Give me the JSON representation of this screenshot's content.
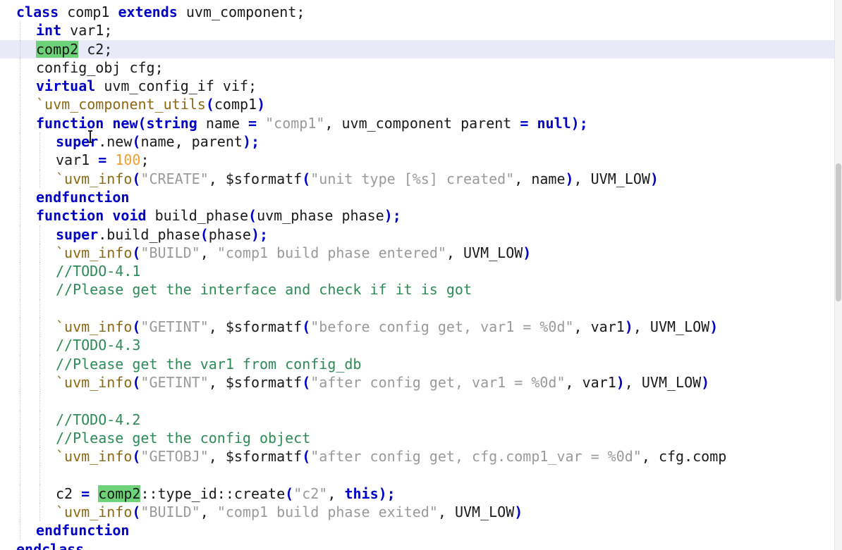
{
  "editor": {
    "language": "systemverilog",
    "current_line": 2,
    "colors": {
      "keyword": "#0000c8",
      "macro": "#8b6914",
      "string": "#9a9a9a",
      "number": "#f0a030",
      "comment": "#2e8b57",
      "match_highlight": "#6ed27a",
      "current_line": "#e8eaf8"
    },
    "lines": [
      {
        "indent": 0,
        "tokens": [
          {
            "t": "kw",
            "v": "class"
          },
          {
            "t": "id",
            "v": " comp1 "
          },
          {
            "t": "kw",
            "v": "extends"
          },
          {
            "t": "id",
            "v": " uvm_component;"
          }
        ]
      },
      {
        "indent": 1,
        "tokens": [
          {
            "t": "kw",
            "v": "int"
          },
          {
            "t": "id",
            "v": " var1;"
          }
        ]
      },
      {
        "indent": 1,
        "tokens": [
          {
            "t": "hl",
            "v": "comp2"
          },
          {
            "t": "id",
            "v": " c2;"
          }
        ]
      },
      {
        "indent": 1,
        "tokens": [
          {
            "t": "id",
            "v": "config_obj cfg;"
          }
        ]
      },
      {
        "indent": 1,
        "tokens": [
          {
            "t": "kw",
            "v": "virtual"
          },
          {
            "t": "id",
            "v": " uvm_config_if vif;"
          }
        ]
      },
      {
        "indent": 1,
        "tokens": [
          {
            "t": "macro",
            "v": "`uvm_component_utils"
          },
          {
            "t": "op",
            "v": "("
          },
          {
            "t": "id",
            "v": "comp1"
          },
          {
            "t": "op",
            "v": ")"
          }
        ]
      },
      {
        "indent": 1,
        "tokens": [
          {
            "t": "kw",
            "v": "function"
          },
          {
            "t": "id",
            "v": " "
          },
          {
            "t": "kw",
            "v": "new"
          },
          {
            "t": "op",
            "v": "("
          },
          {
            "t": "kw",
            "v": "string"
          },
          {
            "t": "id",
            "v": " name "
          },
          {
            "t": "op",
            "v": "="
          },
          {
            "t": "id",
            "v": " "
          },
          {
            "t": "str",
            "v": "\"comp1\""
          },
          {
            "t": "id",
            "v": ", uvm_component parent "
          },
          {
            "t": "op",
            "v": "="
          },
          {
            "t": "id",
            "v": " "
          },
          {
            "t": "kw",
            "v": "null"
          },
          {
            "t": "op",
            "v": ");"
          }
        ]
      },
      {
        "indent": 2,
        "tokens": [
          {
            "t": "kw",
            "v": "super"
          },
          {
            "t": "id",
            "v": ".new"
          },
          {
            "t": "op",
            "v": "("
          },
          {
            "t": "id",
            "v": "name, parent"
          },
          {
            "t": "op",
            "v": ");"
          }
        ]
      },
      {
        "indent": 2,
        "tokens": [
          {
            "t": "id",
            "v": "var1 "
          },
          {
            "t": "op",
            "v": "="
          },
          {
            "t": "id",
            "v": " "
          },
          {
            "t": "num",
            "v": "100"
          },
          {
            "t": "id",
            "v": ";"
          }
        ]
      },
      {
        "indent": 2,
        "tokens": [
          {
            "t": "macro",
            "v": "`uvm_info"
          },
          {
            "t": "op",
            "v": "("
          },
          {
            "t": "str",
            "v": "\"CREATE\""
          },
          {
            "t": "id",
            "v": ", $sformatf"
          },
          {
            "t": "op",
            "v": "("
          },
          {
            "t": "str",
            "v": "\"unit type [%s] created\""
          },
          {
            "t": "id",
            "v": ", name"
          },
          {
            "t": "op",
            "v": ")"
          },
          {
            "t": "id",
            "v": ", UVM_LOW"
          },
          {
            "t": "op",
            "v": ")"
          }
        ]
      },
      {
        "indent": 1,
        "tokens": [
          {
            "t": "kw",
            "v": "endfunction"
          }
        ]
      },
      {
        "indent": 1,
        "tokens": [
          {
            "t": "kw",
            "v": "function"
          },
          {
            "t": "id",
            "v": " "
          },
          {
            "t": "kw",
            "v": "void"
          },
          {
            "t": "id",
            "v": " build_phase"
          },
          {
            "t": "op",
            "v": "("
          },
          {
            "t": "id",
            "v": "uvm_phase phase"
          },
          {
            "t": "op",
            "v": ");"
          }
        ]
      },
      {
        "indent": 2,
        "tokens": [
          {
            "t": "kw",
            "v": "super"
          },
          {
            "t": "id",
            "v": ".build_phase"
          },
          {
            "t": "op",
            "v": "("
          },
          {
            "t": "id",
            "v": "phase"
          },
          {
            "t": "op",
            "v": ");"
          }
        ]
      },
      {
        "indent": 2,
        "tokens": [
          {
            "t": "macro",
            "v": "`uvm_info"
          },
          {
            "t": "op",
            "v": "("
          },
          {
            "t": "str",
            "v": "\"BUILD\""
          },
          {
            "t": "id",
            "v": ", "
          },
          {
            "t": "str",
            "v": "\"comp1 build phase entered\""
          },
          {
            "t": "id",
            "v": ", UVM_LOW"
          },
          {
            "t": "op",
            "v": ")"
          }
        ]
      },
      {
        "indent": 2,
        "tokens": [
          {
            "t": "cmt",
            "v": "//TODO-4.1"
          }
        ]
      },
      {
        "indent": 2,
        "tokens": [
          {
            "t": "cmt",
            "v": "//Please get the interface and check if it is got"
          }
        ]
      },
      {
        "indent": 2,
        "tokens": []
      },
      {
        "indent": 2,
        "tokens": [
          {
            "t": "macro",
            "v": "`uvm_info"
          },
          {
            "t": "op",
            "v": "("
          },
          {
            "t": "str",
            "v": "\"GETINT\""
          },
          {
            "t": "id",
            "v": ", $sformatf"
          },
          {
            "t": "op",
            "v": "("
          },
          {
            "t": "str",
            "v": "\"before config get, var1 = %0d\""
          },
          {
            "t": "id",
            "v": ", var1"
          },
          {
            "t": "op",
            "v": ")"
          },
          {
            "t": "id",
            "v": ", UVM_LOW"
          },
          {
            "t": "op",
            "v": ")"
          }
        ]
      },
      {
        "indent": 2,
        "tokens": [
          {
            "t": "cmt",
            "v": "//TODO-4.3"
          }
        ]
      },
      {
        "indent": 2,
        "tokens": [
          {
            "t": "cmt",
            "v": "//Please get the var1 from config_db"
          }
        ]
      },
      {
        "indent": 2,
        "tokens": [
          {
            "t": "macro",
            "v": "`uvm_info"
          },
          {
            "t": "op",
            "v": "("
          },
          {
            "t": "str",
            "v": "\"GETINT\""
          },
          {
            "t": "id",
            "v": ", $sformatf"
          },
          {
            "t": "op",
            "v": "("
          },
          {
            "t": "str",
            "v": "\"after config get, var1 = %0d\""
          },
          {
            "t": "id",
            "v": ", var1"
          },
          {
            "t": "op",
            "v": ")"
          },
          {
            "t": "id",
            "v": ", UVM_LOW"
          },
          {
            "t": "op",
            "v": ")"
          }
        ]
      },
      {
        "indent": 2,
        "tokens": []
      },
      {
        "indent": 2,
        "tokens": [
          {
            "t": "cmt",
            "v": "//TODO-4.2"
          }
        ]
      },
      {
        "indent": 2,
        "tokens": [
          {
            "t": "cmt",
            "v": "//Please get the config object"
          }
        ]
      },
      {
        "indent": 2,
        "tokens": [
          {
            "t": "macro",
            "v": "`uvm_info"
          },
          {
            "t": "op",
            "v": "("
          },
          {
            "t": "str",
            "v": "\"GETOBJ\""
          },
          {
            "t": "id",
            "v": ", $sformatf"
          },
          {
            "t": "op",
            "v": "("
          },
          {
            "t": "str",
            "v": "\"after config get, cfg.comp1_var = %0d\""
          },
          {
            "t": "id",
            "v": ", cfg.comp"
          }
        ]
      },
      {
        "indent": 2,
        "tokens": []
      },
      {
        "indent": 2,
        "tokens": [
          {
            "t": "id",
            "v": "c2 "
          },
          {
            "t": "op",
            "v": "="
          },
          {
            "t": "id",
            "v": " "
          },
          {
            "t": "hl",
            "v": "comp2"
          },
          {
            "t": "id",
            "v": "::type_id::create"
          },
          {
            "t": "op",
            "v": "("
          },
          {
            "t": "str",
            "v": "\"c2\""
          },
          {
            "t": "id",
            "v": ", "
          },
          {
            "t": "kw",
            "v": "this"
          },
          {
            "t": "op",
            "v": ");"
          }
        ]
      },
      {
        "indent": 2,
        "tokens": [
          {
            "t": "macro",
            "v": "`uvm_info"
          },
          {
            "t": "op",
            "v": "("
          },
          {
            "t": "str",
            "v": "\"BUILD\""
          },
          {
            "t": "id",
            "v": ", "
          },
          {
            "t": "str",
            "v": "\"comp1 build phase exited\""
          },
          {
            "t": "id",
            "v": ", UVM_LOW"
          },
          {
            "t": "op",
            "v": ")"
          }
        ]
      },
      {
        "indent": 1,
        "tokens": [
          {
            "t": "kw",
            "v": "endfunction"
          }
        ]
      },
      {
        "indent": 0,
        "tokens": [
          {
            "t": "kw",
            "v": "endclass"
          }
        ]
      }
    ]
  }
}
